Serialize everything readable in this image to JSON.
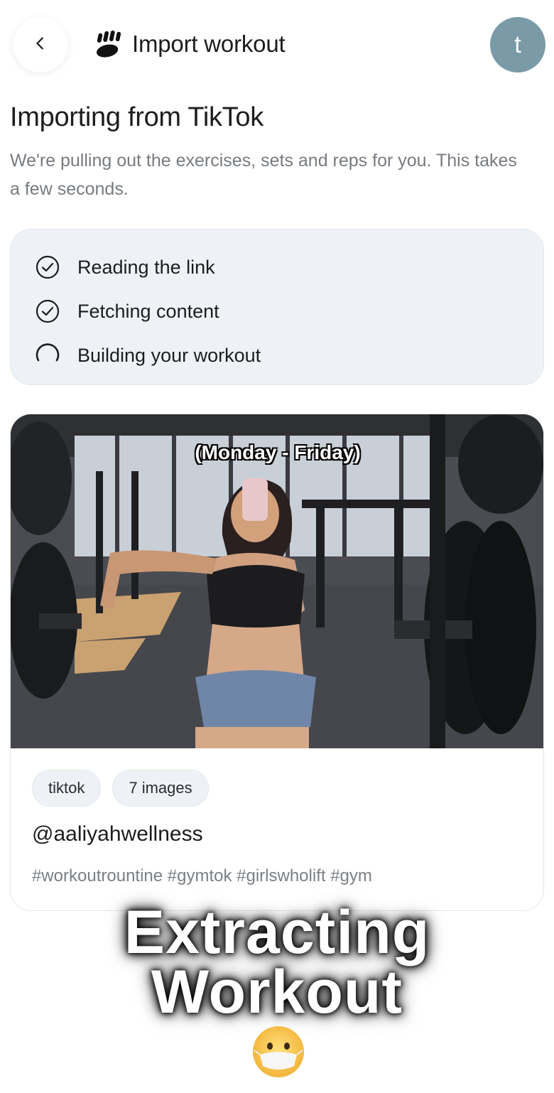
{
  "header": {
    "back_icon": "chevron-left-icon",
    "logo_icon": "fist-logo-icon",
    "title": "Import workout",
    "avatar_initial": "t",
    "avatar_color": "#7a9aa8"
  },
  "intro": {
    "title": "Importing from TikTok",
    "subtitle": "We're pulling out the exercises, sets and reps for you. This takes a few seconds."
  },
  "steps": [
    {
      "label": "Reading the link",
      "status": "done",
      "icon": "check-circle-icon"
    },
    {
      "label": "Fetching content",
      "status": "done",
      "icon": "check-circle-icon"
    },
    {
      "label": "Building your workout",
      "status": "in-progress",
      "icon": "spinner-icon"
    }
  ],
  "post": {
    "image_overlay_text": "(Monday - Friday)",
    "chips": [
      "tiktok",
      "7 images"
    ],
    "author": "@aaliyahwellness",
    "tags": "#workoutrountine #gymtok #girlswholift #gym"
  },
  "caption": {
    "line1": "Extracting",
    "line2": "Workout",
    "emoji_icon": "face-with-mask-emoji-icon"
  }
}
